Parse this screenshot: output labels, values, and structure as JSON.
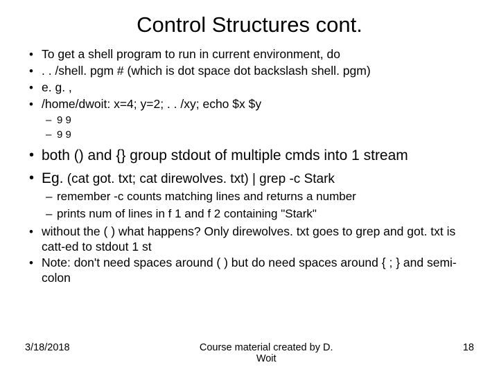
{
  "title": "Control Structures cont.",
  "bullets": {
    "b1": "To get a shell program to run in current environment, do",
    "b2": ".  . /shell. pgm  # (which is dot space dot backslash shell. pgm)",
    "b3": "e. g. ,",
    "b4": "/home/dwoit: x=4; y=2;  .  . /xy; echo $x $y",
    "s1": "9 9",
    "s2": "9 9",
    "b5": "both () and {} group stdout of multiple cmds into 1 stream",
    "b6_prefix": "Eg.",
    "b6_rest": " (cat got. txt; cat direwolves. txt) | grep -c Stark",
    "s3": "remember -c counts matching lines and returns a number",
    "s4": "prints num of lines in f 1 and f 2 containing \"Stark\"",
    "b7": "without the ( ) what happens?   Only direwolves. txt  goes to grep and got. txt is catt-ed to stdout 1 st",
    "b8": "Note: don't need spaces around ( )  but do need spaces around { ; } and semi-colon"
  },
  "footer": {
    "date": "3/18/2018",
    "center": "Course material created by D. Woit",
    "page": "18"
  }
}
